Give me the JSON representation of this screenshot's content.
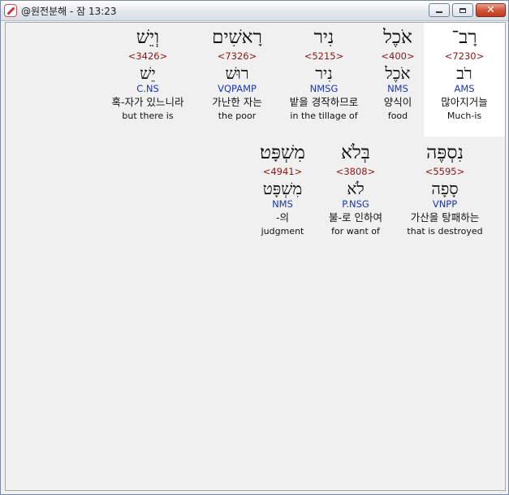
{
  "window": {
    "title": "@원전분해 - 잠 13:23",
    "min_icon": "minimize-icon",
    "max_icon": "maximize-icon",
    "close_icon": "close-icon",
    "close_glyph": "✕"
  },
  "row1": [
    {
      "hebrew": "רָב־",
      "strong": "<7230>",
      "lemma": "רֹב",
      "parse": "AMS",
      "korean": "많아지거늘",
      "english": "Much-is"
    },
    {
      "hebrew": "אֹכֶל",
      "strong": "<400>",
      "lemma": "אֹכֶל",
      "parse": "NMS",
      "korean": "양식이",
      "english": "food"
    },
    {
      "hebrew": "נִיר",
      "strong": "<5215>",
      "lemma": "נִיר",
      "parse": "NMSG",
      "korean": "밭을 경작하므로",
      "english": "in the tillage of"
    },
    {
      "hebrew": "רָאשִׁים",
      "strong": "<7326>",
      "lemma": "רוּשׁ",
      "parse": "VQPAMP",
      "korean": "가난한 자는",
      "english": "the poor"
    },
    {
      "hebrew": "וְיֵשׁ",
      "strong": "<3426>",
      "lemma": "יֵשׁ",
      "parse": "C.NS",
      "korean": "혹-자가 있느니라",
      "english": "but there is"
    }
  ],
  "row2": [
    {
      "hebrew": "נִסְפֶּה",
      "strong": "<5595>",
      "lemma": "סָפָה",
      "parse": "VNPP",
      "korean": "가산을 탕패하는",
      "english": "that is destroyed"
    },
    {
      "hebrew": "בְּלֹא",
      "strong": "<3808>",
      "lemma": "לֹא",
      "parse": "P.NSG",
      "korean": "불-로 인하여",
      "english": "for want of"
    },
    {
      "hebrew": "מִשְׁפָּט׃",
      "strong": "<4941>",
      "lemma": "מִשְׁפָּט",
      "parse": "NMS",
      "korean": "-의",
      "english": "judgment"
    }
  ]
}
